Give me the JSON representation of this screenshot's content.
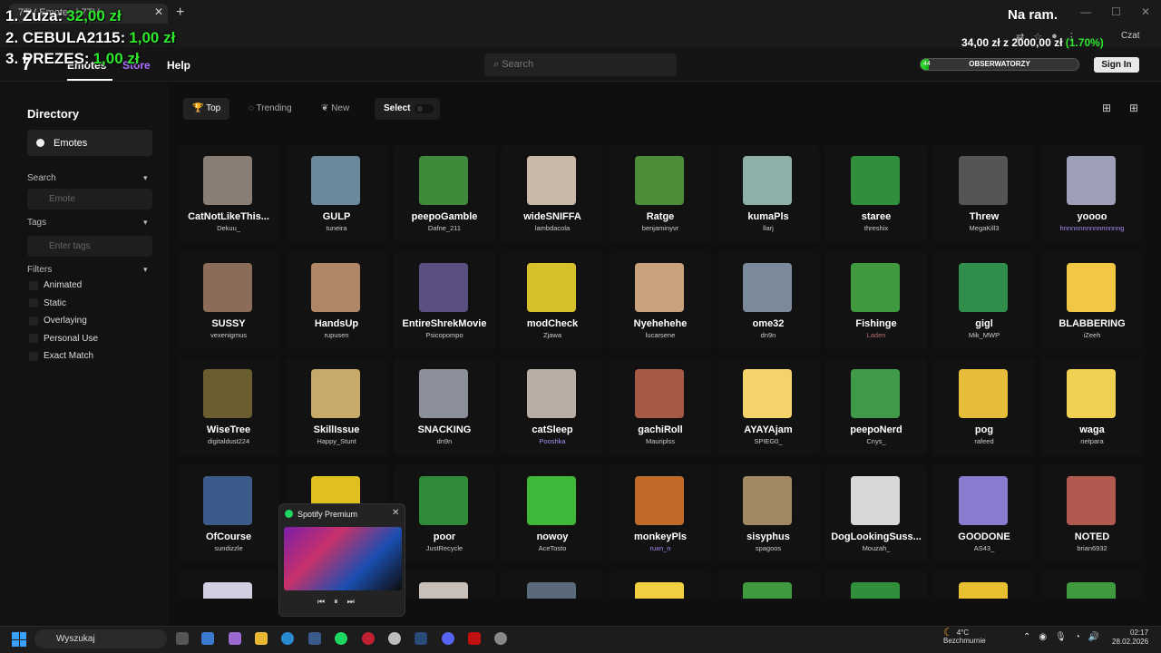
{
  "overlay": {
    "ranking": [
      {
        "label": "1. Zuza:",
        "amount": "32,00 zł"
      },
      {
        "label": "2. CEBULA2115:",
        "amount": "1,00 zł"
      },
      {
        "label": "3. PREZES:",
        "amount": "1,00 zł"
      }
    ],
    "top_right": "Na ram.",
    "goal_text": "34,00 zł z 2000,00 zł",
    "goal_pct": "(1.70%)",
    "goal_progress": 0.017,
    "goal_label": "OBSERWATORZY",
    "goal_count": "44"
  },
  "browser": {
    "tab_title": "7TV Emotes | 7TV",
    "new_tab": "+",
    "chat_label": "Czat"
  },
  "app": {
    "logo": "7",
    "nav": {
      "emotes": "Emotes",
      "store": "Store",
      "help": "Help"
    },
    "search_placeholder": "Search",
    "sign_in": "Sign In",
    "menu_icon": "☰"
  },
  "sidebar": {
    "title": "Directory",
    "emotes": "Emotes",
    "search_head": "Search",
    "search_placeholder": "Emote",
    "tags_head": "Tags",
    "tags_placeholder": "Enter tags",
    "filters_head": "Filters",
    "filters": [
      "Animated",
      "Static",
      "Overlaying",
      "Personal Use",
      "Exact Match"
    ]
  },
  "toolbar": {
    "top": "Top",
    "trending": "Trending",
    "new": "New",
    "select": "Select"
  },
  "emotes": [
    {
      "name": "CatNotLikeThis...",
      "author": "Dekuu_",
      "color": "#8a7d74"
    },
    {
      "name": "GULP",
      "author": "tuneira",
      "color": "#6a8a9c"
    },
    {
      "name": "peepoGamble",
      "author": "Dafne_211",
      "color": "#3f8a3a"
    },
    {
      "name": "wideSNIFFA",
      "author": "lambdacola",
      "color": "#c9b9a9"
    },
    {
      "name": "Ratge",
      "author": "benjaminyvr",
      "color": "#4d8d3a"
    },
    {
      "name": "kumaPls",
      "author": "llarj",
      "color": "#8fb0a9"
    },
    {
      "name": "staree",
      "author": "threshix",
      "color": "#2f8f3a"
    },
    {
      "name": "Threw",
      "author": "MegaKill3",
      "color": "#555555"
    },
    {
      "name": "yoooo",
      "author": "hnnnnnnnnnnnnnnng",
      "color": "#9c9fb6",
      "authorColor": "#a98cf0"
    },
    {
      "name": "SUSSY",
      "author": "vexenigmus",
      "color": "#8a6c58"
    },
    {
      "name": "HandsUp",
      "author": "rupusen",
      "color": "#b08666"
    },
    {
      "name": "EntireShrekMovie",
      "author": "Psicopompo",
      "color": "#5a4f80"
    },
    {
      "name": "modCheck",
      "author": "Zjawa",
      "color": "#d8c02a"
    },
    {
      "name": "Nyehehehe",
      "author": "lucarsene",
      "color": "#c9a27c"
    },
    {
      "name": "ome32",
      "author": "dn9n",
      "color": "#7a8a9a"
    },
    {
      "name": "Fishinge",
      "author": "Laden",
      "color": "#3f9a3f",
      "authorColor": "#b06b6b"
    },
    {
      "name": "gigl",
      "author": "Mik_MWP",
      "color": "#2f8f4a"
    },
    {
      "name": "BLABBERING",
      "author": "iZeeh",
      "color": "#f2c744"
    },
    {
      "name": "WiseTree",
      "author": "digitaldust224",
      "color": "#6a5d2f"
    },
    {
      "name": "SkillIssue",
      "author": "Happy_Stunt",
      "color": "#c7a96a"
    },
    {
      "name": "SNACKING",
      "author": "dn9n",
      "color": "#8a8f9a"
    },
    {
      "name": "catSleep",
      "author": "Pooshka",
      "color": "#b8aea4",
      "authorColor": "#a98cf0"
    },
    {
      "name": "gachiRoll",
      "author": "Mauriplss",
      "color": "#a65a45"
    },
    {
      "name": "AYAYAjam",
      "author": "SPIEG0_",
      "color": "#f4d36a"
    },
    {
      "name": "peepoNerd",
      "author": "Cnys_",
      "color": "#3f9a4a"
    },
    {
      "name": "pog",
      "author": "rafeed",
      "color": "#e7bc3a"
    },
    {
      "name": "waga",
      "author": "netpara",
      "color": "#f0d050"
    },
    {
      "name": "OfCourse",
      "author": "sundizzle",
      "color": "#3c5a8a"
    },
    {
      "name": "",
      "author": "",
      "color": "#e0c020"
    },
    {
      "name": "poor",
      "author": "JustRecycle",
      "color": "#2f8a3a"
    },
    {
      "name": "nowoy",
      "author": "AceTosto",
      "color": "#3fb83a"
    },
    {
      "name": "monkeyPls",
      "author": "ruxn_n",
      "color": "#c06a2a",
      "authorColor": "#a98cf0"
    },
    {
      "name": "sisyphus",
      "author": "spagoos",
      "color": "#a08860"
    },
    {
      "name": "DogLookingSuss...",
      "author": "Mouzah_",
      "color": "#d8d8d8"
    },
    {
      "name": "GOODONE",
      "author": "AS43_",
      "color": "#8a7ad0"
    },
    {
      "name": "NOTED",
      "author": "brian6932",
      "color": "#b05a50"
    },
    {
      "name": "",
      "author": "",
      "color": "#d0d0e0"
    },
    {
      "name": "",
      "author": "",
      "color": "#222222"
    },
    {
      "name": "",
      "author": "",
      "color": "#c8c0b8"
    },
    {
      "name": "",
      "author": "",
      "color": "#5a6a7a"
    },
    {
      "name": "",
      "author": "",
      "color": "#f0d040"
    },
    {
      "name": "",
      "author": "",
      "color": "#3f9a3f"
    },
    {
      "name": "",
      "author": "",
      "color": "#2f8f3a"
    },
    {
      "name": "",
      "author": "",
      "color": "#e8c030"
    },
    {
      "name": "",
      "author": "",
      "color": "#3f9a3f"
    }
  ],
  "spotify": {
    "title": "Spotify Premium",
    "close": "✕",
    "prev": "⏮",
    "pause": "⏸",
    "next": "⏭"
  },
  "taskbar": {
    "search": "Wyszukaj",
    "weather_temp": "4°C",
    "weather_desc": "Bezchmurnie",
    "time": "02:17",
    "date": "28.02.2026"
  }
}
